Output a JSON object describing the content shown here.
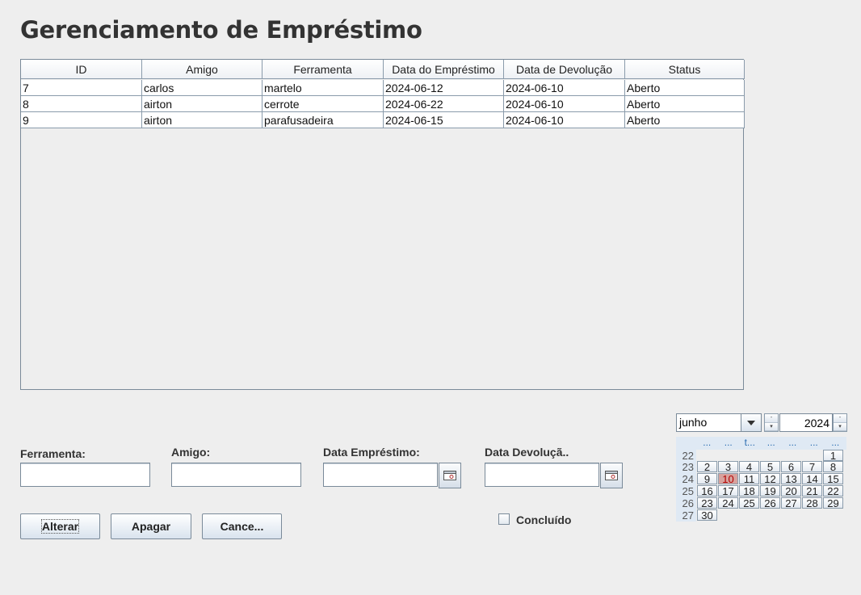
{
  "page": {
    "title": "Gerenciamento de Empréstimo"
  },
  "table": {
    "headers": [
      "ID",
      "Amigo",
      "Ferramenta",
      "Data do Empréstimo",
      "Data de Devolução",
      "Status"
    ],
    "rows": [
      [
        "7",
        "carlos",
        "martelo",
        "2024-06-12",
        "2024-06-10",
        "Aberto"
      ],
      [
        "8",
        "airton",
        "cerrote",
        "2024-06-22",
        "2024-06-10",
        "Aberto"
      ],
      [
        "9",
        "airton",
        "parafusadeira",
        "2024-06-15",
        "2024-06-10",
        "Aberto"
      ]
    ]
  },
  "form": {
    "ferramenta_label": "Ferramenta:",
    "ferramenta_value": "",
    "amigo_label": "Amigo:",
    "amigo_value": "",
    "data_emprestimo_label": "Data Empréstimo:",
    "data_emprestimo_value": "",
    "data_devolucao_label": "Data Devoluçã..",
    "data_devolucao_value": "",
    "concluido_label": "Concluído",
    "concluido_checked": false
  },
  "buttons": {
    "alterar": "Alterar",
    "apagar": "Apagar",
    "cancelar": "Cance..."
  },
  "calendar": {
    "month": "junho",
    "year": "2024",
    "weekday_headers": [
      "...",
      "...",
      "t...",
      "...",
      "...",
      "...",
      "..."
    ],
    "week_numbers": [
      "22",
      "23",
      "24",
      "25",
      "26",
      "27"
    ],
    "weeks": [
      [
        "",
        "",
        "",
        "",
        "",
        "",
        "1"
      ],
      [
        "2",
        "3",
        "4",
        "5",
        "6",
        "7",
        "8"
      ],
      [
        "9",
        "10",
        "11",
        "12",
        "13",
        "14",
        "15"
      ],
      [
        "16",
        "17",
        "18",
        "19",
        "20",
        "21",
        "22"
      ],
      [
        "23",
        "24",
        "25",
        "26",
        "27",
        "28",
        "29"
      ],
      [
        "30",
        "",
        "",
        "",
        "",
        "",
        ""
      ]
    ],
    "selected_day": "10",
    "selected_color": "#d7a29d"
  },
  "icons": {
    "calendar_button": "calendar-icon",
    "combo_arrow": "chevron-down-icon",
    "spinner_up": "arrow-up-icon",
    "spinner_down": "arrow-down-icon"
  }
}
